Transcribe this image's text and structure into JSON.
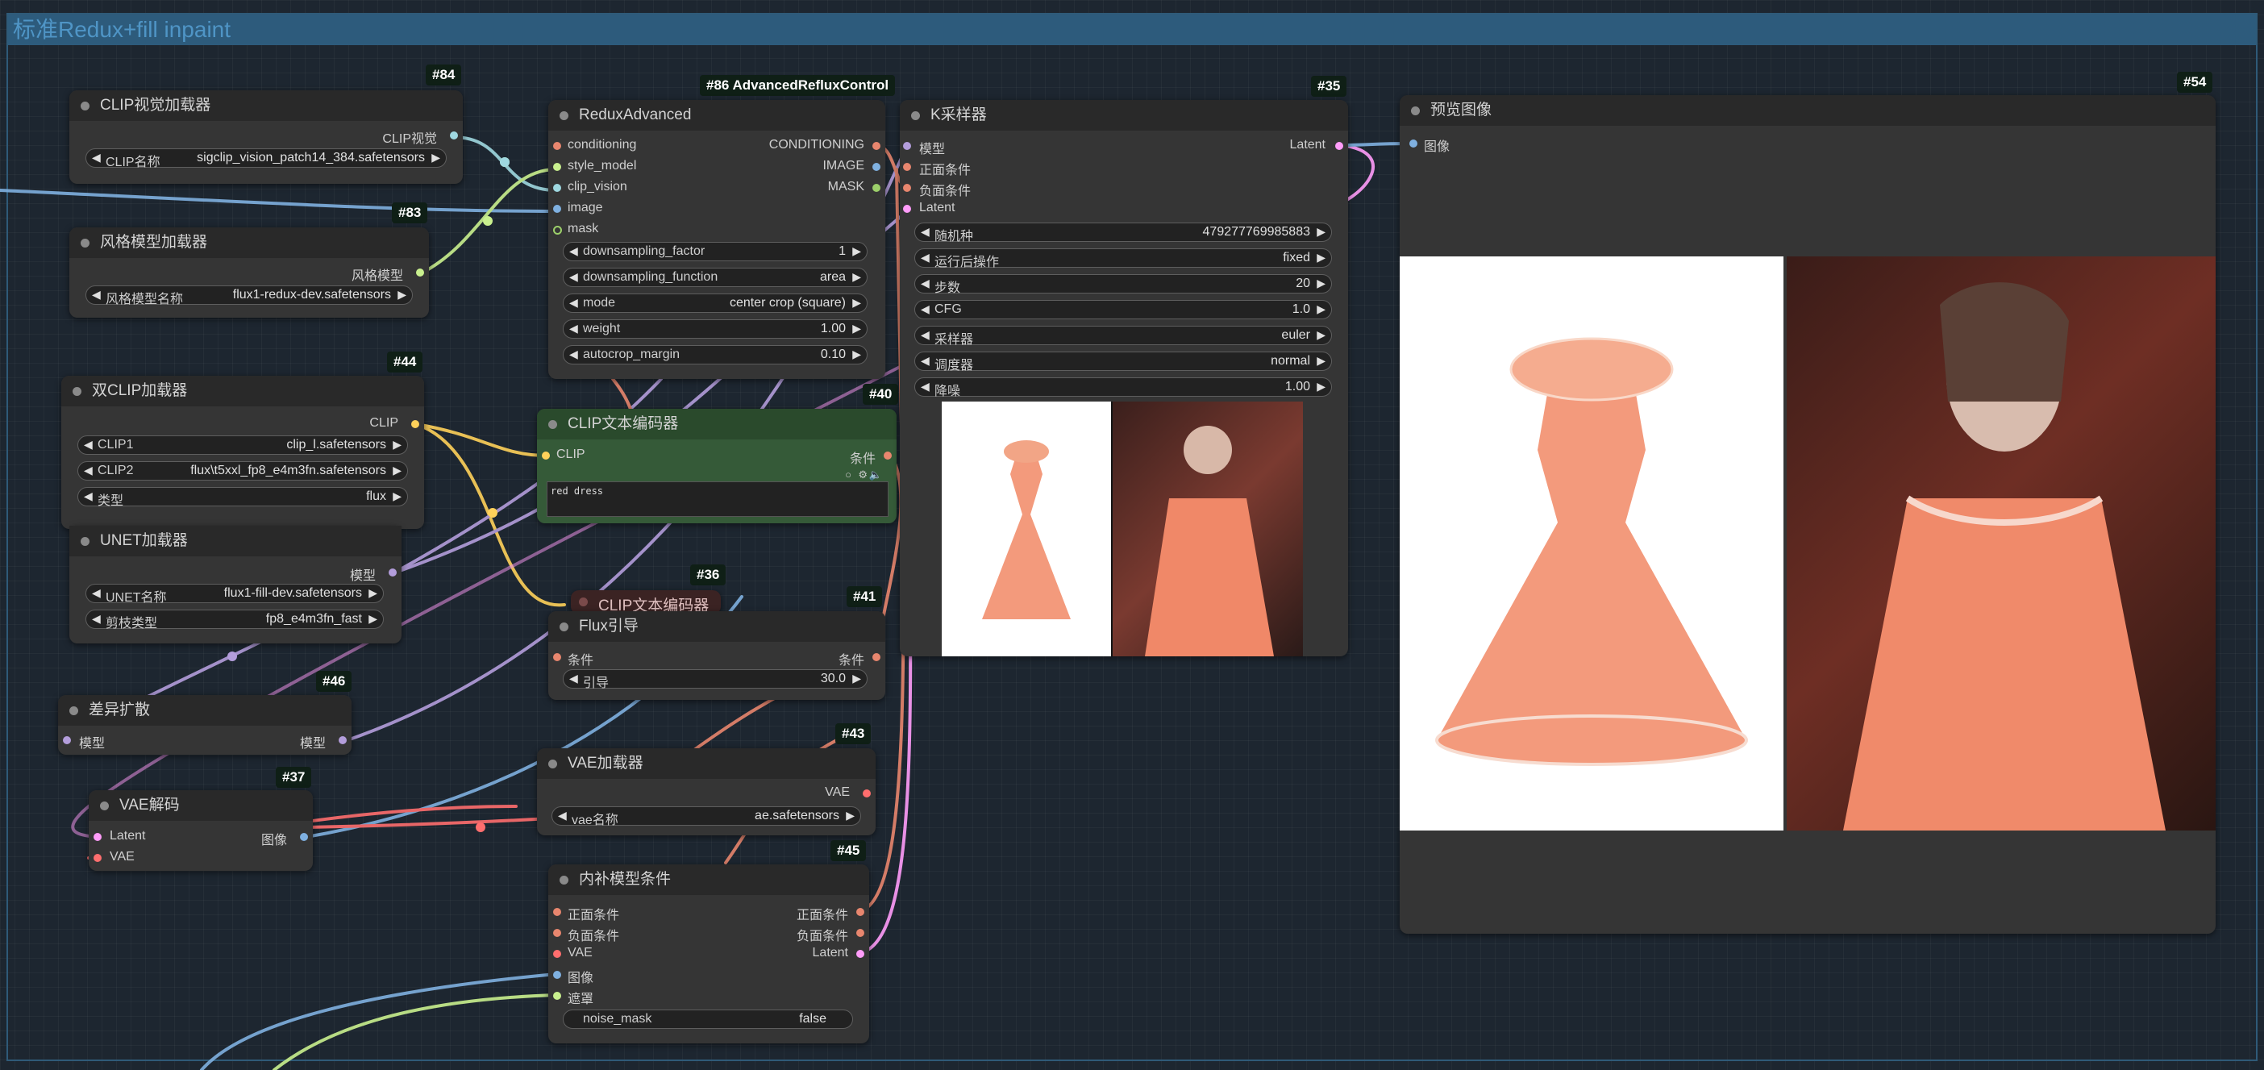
{
  "group_title": "标准Redux+fill inpaint",
  "colors": {
    "background": "#1d2630",
    "group_header": "#2d5b7c",
    "node_body": "#353535",
    "node_title": "#292929",
    "clip_node_body": "#355a38",
    "clip_node_title": "#2a4a2c",
    "wire_conditioning": "#e8866e",
    "wire_clip_vision": "#9fd8e0",
    "wire_style_model": "#c9f08e",
    "wire_clip": "#ffd15a",
    "wire_model": "#b39ddb",
    "wire_image": "#7fb0e0",
    "wire_vae": "#ff6e6e",
    "wire_latent": "#ff9cf9"
  },
  "nodes": {
    "clip_vision_loader": {
      "id": "#84",
      "title": "CLIP视觉加载器",
      "outputs": [
        "CLIP视觉"
      ],
      "widgets": [
        {
          "label": "CLIP名称",
          "value": "sigclip_vision_patch14_384.safetensors"
        }
      ]
    },
    "style_model_loader": {
      "id": "#83",
      "title": "风格模型加载器",
      "outputs": [
        "风格模型"
      ],
      "widgets": [
        {
          "label": "风格模型名称",
          "value": "flux1-redux-dev.safetensors"
        }
      ]
    },
    "dual_clip_loader": {
      "id": "#44",
      "title": "双CLIP加载器",
      "outputs": [
        "CLIP"
      ],
      "widgets": [
        {
          "label": "CLIP1",
          "value": "clip_l.safetensors"
        },
        {
          "label": "CLIP2",
          "value": "flux\\t5xxl_fp8_e4m3fn.safetensors"
        },
        {
          "label": "类型",
          "value": "flux"
        }
      ]
    },
    "unet_loader": {
      "title": "UNET加载器",
      "outputs": [
        "模型"
      ],
      "widgets": [
        {
          "label": "UNET名称",
          "value": "flux1-fill-dev.safetensors"
        },
        {
          "label": "剪枝类型",
          "value": "fp8_e4m3fn_fast"
        }
      ]
    },
    "diff_diffusion": {
      "id": "#46",
      "title": "差异扩散",
      "inputs": [
        "模型"
      ],
      "outputs": [
        "模型"
      ]
    },
    "vae_decode": {
      "id": "#37",
      "title": "VAE解码",
      "inputs": [
        "Latent",
        "VAE"
      ],
      "outputs": [
        "图像"
      ]
    },
    "redux_advanced": {
      "id": "#86 AdvancedRefluxControl",
      "title": "ReduxAdvanced",
      "inputs": [
        "conditioning",
        "style_model",
        "clip_vision",
        "image",
        "mask"
      ],
      "outputs": [
        "CONDITIONING",
        "IMAGE",
        "MASK"
      ],
      "widgets": [
        {
          "label": "downsampling_factor",
          "value": "1"
        },
        {
          "label": "downsampling_function",
          "value": "area"
        },
        {
          "label": "mode",
          "value": "center crop (square)"
        },
        {
          "label": "weight",
          "value": "1.00"
        },
        {
          "label": "autocrop_margin",
          "value": "0.10"
        }
      ]
    },
    "clip_text_encoder": {
      "id": "#40",
      "title": "CLIP文本编码器",
      "inputs": [
        "CLIP"
      ],
      "outputs": [
        "条件"
      ],
      "text": "red dress"
    },
    "clip_text_encoder_2": {
      "id": "#36",
      "title": "CLIP文本编码器"
    },
    "flux_guidance": {
      "id": "#41",
      "title": "Flux引导",
      "inputs": [
        "条件"
      ],
      "outputs": [
        "条件"
      ],
      "widgets": [
        {
          "label": "引导",
          "value": "30.0"
        }
      ]
    },
    "vae_loader": {
      "id": "#43",
      "title": "VAE加载器",
      "outputs": [
        "VAE"
      ],
      "widgets": [
        {
          "label": "vae名称",
          "value": "ae.safetensors"
        }
      ]
    },
    "inpaint_conditioning": {
      "id": "#45",
      "title": "内补模型条件",
      "inputs": [
        "正面条件",
        "负面条件",
        "VAE",
        "图像",
        "遮罩"
      ],
      "outputs": [
        "正面条件",
        "负面条件",
        "Latent"
      ],
      "widgets": [
        {
          "label": "noise_mask",
          "value": "false"
        }
      ]
    },
    "ksampler": {
      "id": "#35",
      "title": "K采样器",
      "inputs": [
        "模型",
        "正面条件",
        "负面条件",
        "Latent"
      ],
      "outputs": [
        "Latent"
      ],
      "widgets": [
        {
          "label": "随机种",
          "value": "479277769985883"
        },
        {
          "label": "运行后操作",
          "value": "fixed"
        },
        {
          "label": "步数",
          "value": "20"
        },
        {
          "label": "CFG",
          "value": "1.0"
        },
        {
          "label": "采样器",
          "value": "euler"
        },
        {
          "label": "调度器",
          "value": "normal"
        },
        {
          "label": "降噪",
          "value": "1.00"
        }
      ]
    },
    "preview_image": {
      "id": "#54",
      "title": "预览图像",
      "inputs": [
        "图像"
      ]
    }
  }
}
